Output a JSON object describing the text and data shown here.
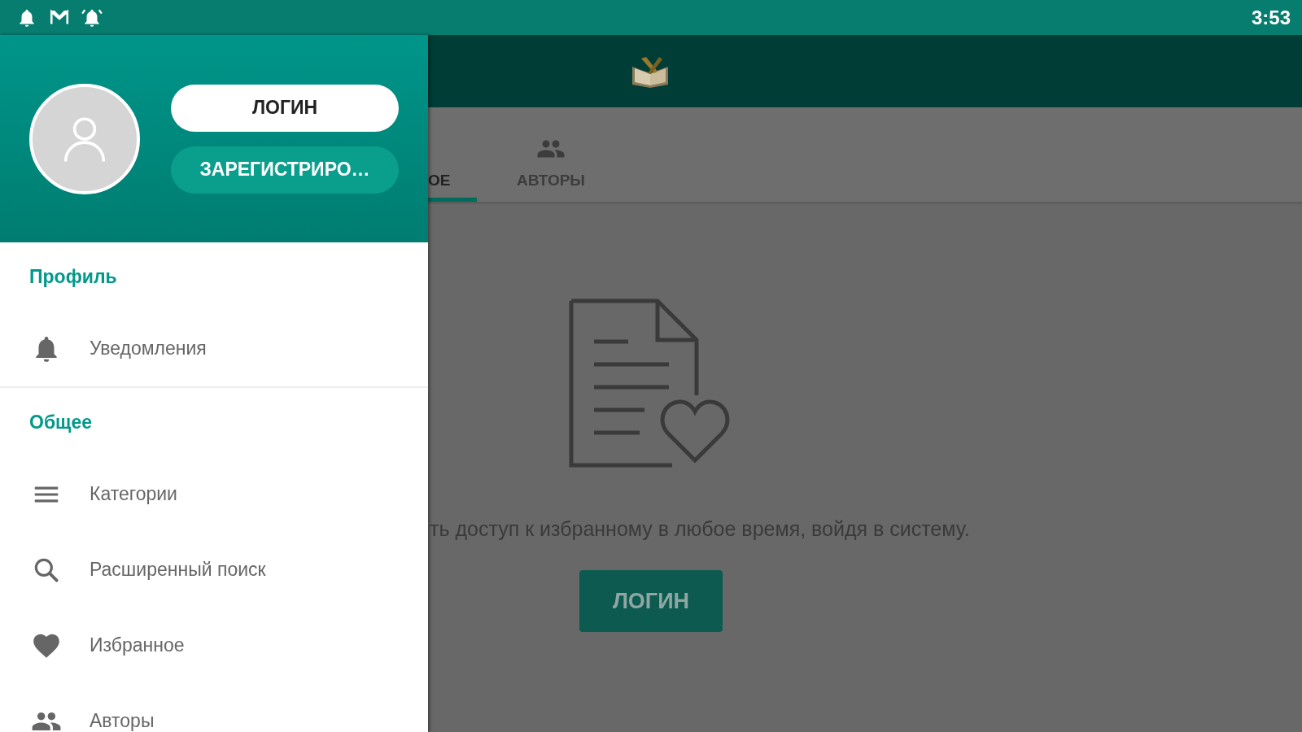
{
  "status_bar": {
    "time": "3:53"
  },
  "drawer": {
    "login_button": "ЛОГИН",
    "register_button": "ЗАРЕГИСТРИРО…",
    "sections": [
      {
        "title": "Профиль",
        "items": [
          {
            "label": "Уведомления"
          }
        ]
      },
      {
        "title": "Общее",
        "items": [
          {
            "label": "Категории"
          },
          {
            "label": "Расширенный поиск"
          },
          {
            "label": "Избранное"
          },
          {
            "label": "Авторы"
          }
        ]
      }
    ]
  },
  "tabs": [
    {
      "label": "ОЕ",
      "selected": true
    },
    {
      "label": "АВТОРЫ",
      "selected": false
    }
  ],
  "message": "ть доступ к избранному в любое время, войдя в систему.",
  "login_button": "ЛОГИН"
}
